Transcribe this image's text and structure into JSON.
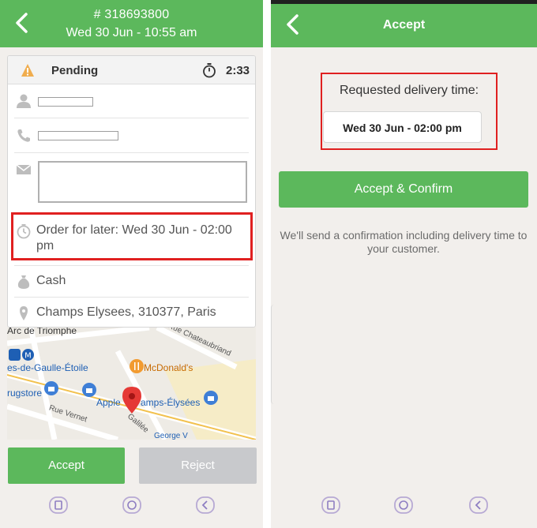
{
  "left_screen": {
    "header": {
      "order_number": "# 318693800",
      "order_datetime": "Wed 30 Jun - 10:55 am"
    },
    "status": {
      "label": "Pending",
      "timer": "2:33"
    },
    "order_for_later": "Order for later: Wed 30 Jun - 02:00 pm",
    "payment": "Cash",
    "address": "Champs Elysees, 310377, Paris",
    "map": {
      "labels": [
        "Arc de Triomphe",
        "es-de-Gaulle-Étoile",
        "McDonald's",
        "rugstore",
        "Apple",
        "amps-Élysées",
        "Rue Vernet",
        "Rue Chateaubriand",
        "Galilée",
        "George V"
      ]
    },
    "buttons": {
      "accept": "Accept",
      "reject": "Reject"
    }
  },
  "right_screen": {
    "header": {
      "title": "Accept"
    },
    "requested_label": "Requested delivery time:",
    "requested_time": "Wed 30 Jun - 02:00 pm",
    "confirm_button": "Accept & Confirm",
    "note": "We'll send a confirmation including delivery time to your customer."
  },
  "colors": {
    "brand_green": "#5cb85c",
    "highlight_red": "#e02020",
    "disabled_gray": "#c8c9cc",
    "pin_red": "#e53935",
    "warning_orange": "#f0ad4e"
  },
  "icons": [
    "back-icon",
    "warning-icon",
    "timer-icon",
    "person-icon",
    "phone-icon",
    "mail-icon",
    "clock-icon",
    "money-bag-icon",
    "location-pin-icon",
    "map-pin-icon",
    "nav-recent-icon",
    "nav-home-icon",
    "nav-back-icon"
  ]
}
